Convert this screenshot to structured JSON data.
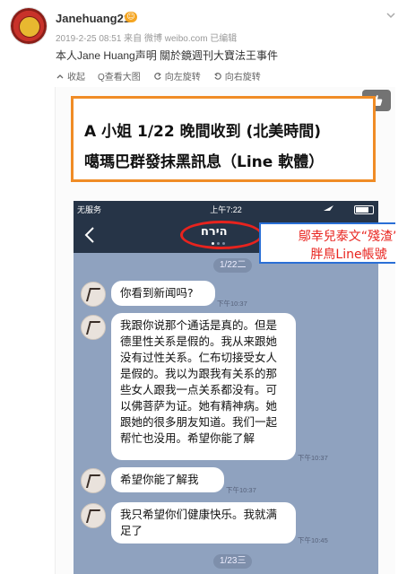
{
  "post": {
    "username": "Janehuang21",
    "badge": "☺",
    "meta": "2019-2-25 08:51 来自 微博 weibo.com 已编辑",
    "text": "本人Jane Huang声明 關於鏡週刊大寶法王事件",
    "menu_icon": "chevron-down-icon",
    "toolbar": [
      {
        "label": "收起",
        "icon": "collapse-icon"
      },
      {
        "label": "Q查看大图",
        "icon": "zoom-icon"
      },
      {
        "label": "向左旋转",
        "icon": "rotate-left-icon"
      },
      {
        "label": "向右旋转",
        "icon": "rotate-right-icon"
      }
    ]
  },
  "image": {
    "headline_line1": "A 小姐 1/22 晚間收到 (北美時間)",
    "headline_line2": "噶瑪巴群發抹黑訊息（Line 軟體）",
    "headline_border_color": "#f08c26",
    "annotation_line1": "鄔幸兒泰文“殘渣”",
    "annotation_line2": "胖鳥Line帳號",
    "annotation_color": "#e8231e",
    "annotation_border_color": "#2a6fd6"
  },
  "phone": {
    "status": {
      "carrier": "无服务",
      "time": "上午7:22"
    },
    "chat_name": "הירח",
    "date_1": "1/22二",
    "date_2": "1/23三",
    "messages": [
      {
        "text": "你看到新闻吗?",
        "time": "下午10:37"
      },
      {
        "text": "我跟你说那个通话是真的。但是德里性关系是假的。我从来跟她没有过性关系。仁布切接受女人是假的。我以为跟我有关系的那些女人跟我一点关系都没有。可以佛菩萨为证。她有精神病。她跟她的很多朋友知道。我们一起帮忙也没用。希望你能了解",
        "time": "下午10:37"
      },
      {
        "text": "希望你能了解我",
        "time": "下午10:37"
      },
      {
        "text": "我只希望你们健康快乐。我就满足了",
        "time": "下午10:45"
      }
    ]
  }
}
